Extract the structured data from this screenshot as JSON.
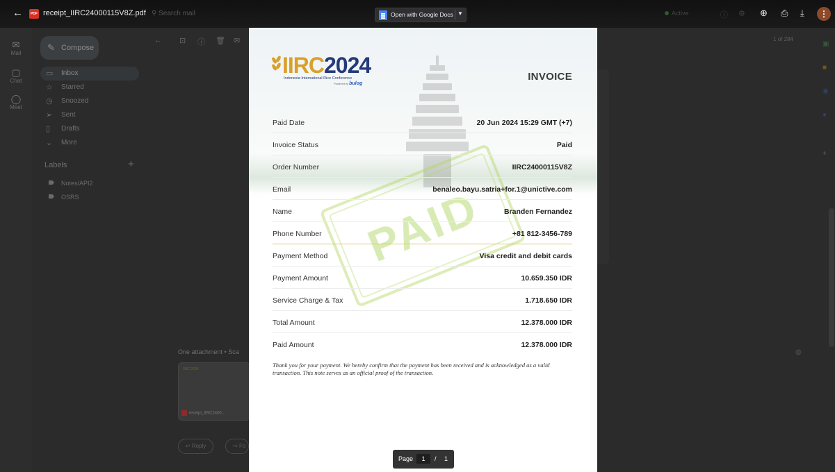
{
  "viewer": {
    "file_name": "receipt_IIRC24000115V8Z.pdf",
    "pdf_badge": "PDF",
    "open_with_label": "Open with Google Docs",
    "page_label": "Page",
    "page_current": "1",
    "page_separator": "/",
    "page_total": "1"
  },
  "gmail_background": {
    "search_placeholder": "Search mail",
    "status": "Active",
    "rail": [
      "Mail",
      "Chat",
      "Meet"
    ],
    "compose_label": "Compose",
    "nav": [
      "Inbox",
      "Starred",
      "Snoozed",
      "Sent",
      "Drafts",
      "More"
    ],
    "labels_heading": "Labels",
    "labels": [
      "Notes/API2",
      "OSRS"
    ],
    "pager": "1 of 284",
    "attachment_line": "One attachment • Sca",
    "attachment_name": "receipt_IIRC2400...",
    "reply_label": "Reply",
    "forward_label": "Fo"
  },
  "invoice": {
    "logo_main_a": "IIRC",
    "logo_main_b": "2024",
    "logo_subtitle": "Indonesia International Rice Conference",
    "logo_powered": "Powered by",
    "logo_partner": "bulog",
    "title": "INVOICE",
    "rows": [
      {
        "label": "Paid Date",
        "value": "20 Jun 2024 15:29 GMT (+7)"
      },
      {
        "label": "Invoice Status",
        "value": "Paid"
      },
      {
        "label": "Order Number",
        "value": "IIRC24000115V8Z"
      },
      {
        "label": "Email",
        "value": "benaleo.bayu.satria+for.1@unictive.com"
      },
      {
        "label": "Name",
        "value": "Branden Fernandez"
      },
      {
        "label": "Phone Number",
        "value": "+81 812-3456-789"
      },
      {
        "label": "Payment Method",
        "value": "Visa credit and debit cards"
      },
      {
        "label": "Payment Amount",
        "value": "10.659.350 IDR"
      },
      {
        "label": "Service Charge & Tax",
        "value": "1.718.650 IDR"
      },
      {
        "label": "Total Amount",
        "value": "12.378.000 IDR"
      },
      {
        "label": "Paid Amount",
        "value": "12.378.000 IDR"
      }
    ],
    "stamp_text": "PAID",
    "thank_you_note": "Thank you for your payment. We hereby confirm that the payment has been received and is acknowledged as a valid transaction. This note serves as an official proof of the transaction."
  },
  "colors": {
    "accent_gold": "#d9a02a",
    "brand_blue": "#243a7a",
    "stamp_green": "#aad25a",
    "docs_blue": "#4285f4"
  }
}
